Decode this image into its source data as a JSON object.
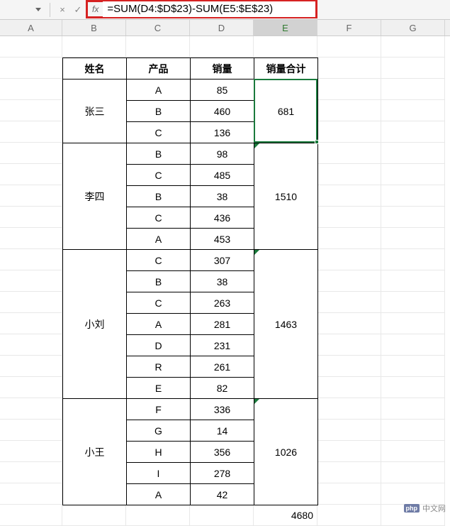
{
  "formula_bar": {
    "cancel_icon": "×",
    "enter_icon": "✓",
    "fx_label": "fx",
    "formula": "=SUM(D4:$D$23)-SUM(E5:$E$23)"
  },
  "columns": [
    "A",
    "B",
    "C",
    "D",
    "E",
    "F",
    "G"
  ],
  "selected_column": "E",
  "headers": {
    "name": "姓名",
    "product": "产品",
    "sales": "销量",
    "total": "销量合计"
  },
  "chart_data": {
    "type": "table",
    "groups": [
      {
        "name": "张三",
        "total": 681,
        "rows": [
          {
            "product": "A",
            "sales": 85
          },
          {
            "product": "B",
            "sales": 460
          },
          {
            "product": "C",
            "sales": 136
          }
        ]
      },
      {
        "name": "李四",
        "total": 1510,
        "rows": [
          {
            "product": "B",
            "sales": 98
          },
          {
            "product": "C",
            "sales": 485
          },
          {
            "product": "B",
            "sales": 38
          },
          {
            "product": "C",
            "sales": 436
          },
          {
            "product": "A",
            "sales": 453
          }
        ]
      },
      {
        "name": "小刘",
        "total": 1463,
        "rows": [
          {
            "product": "C",
            "sales": 307
          },
          {
            "product": "B",
            "sales": 38
          },
          {
            "product": "C",
            "sales": 263
          },
          {
            "product": "A",
            "sales": 281
          },
          {
            "product": "D",
            "sales": 231
          },
          {
            "product": "R",
            "sales": 261
          },
          {
            "product": "E",
            "sales": 82
          }
        ]
      },
      {
        "name": "小王",
        "total": 1026,
        "rows": [
          {
            "product": "F",
            "sales": 336
          },
          {
            "product": "G",
            "sales": 14
          },
          {
            "product": "H",
            "sales": 356
          },
          {
            "product": "I",
            "sales": 278
          },
          {
            "product": "A",
            "sales": 42
          }
        ]
      }
    ],
    "grand_total": 4680
  },
  "watermark": {
    "badge": "php",
    "text": "中文网"
  }
}
